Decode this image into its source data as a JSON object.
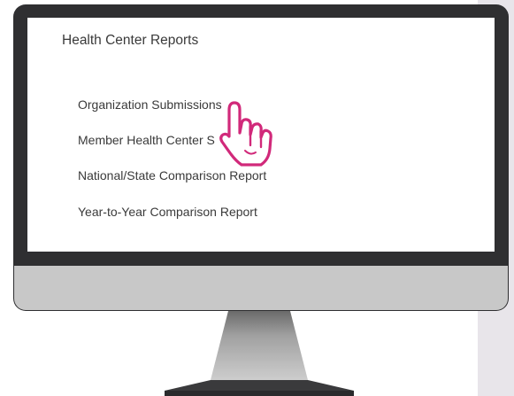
{
  "screen": {
    "title": "Health Center Reports",
    "reports": [
      {
        "label": "Organization Submissions"
      },
      {
        "label": "Member Health Center S"
      },
      {
        "label": "National/State Comparison Report"
      },
      {
        "label": "Year-to-Year Comparison Report"
      }
    ]
  },
  "cursor": {
    "icon": "pointing-hand-icon",
    "color": "#d1297a"
  },
  "colors": {
    "bezel": "#2f2f31",
    "chin": "#c8c8c8",
    "right_strip": "#e8e5ea",
    "text": "#3a3a3a"
  }
}
